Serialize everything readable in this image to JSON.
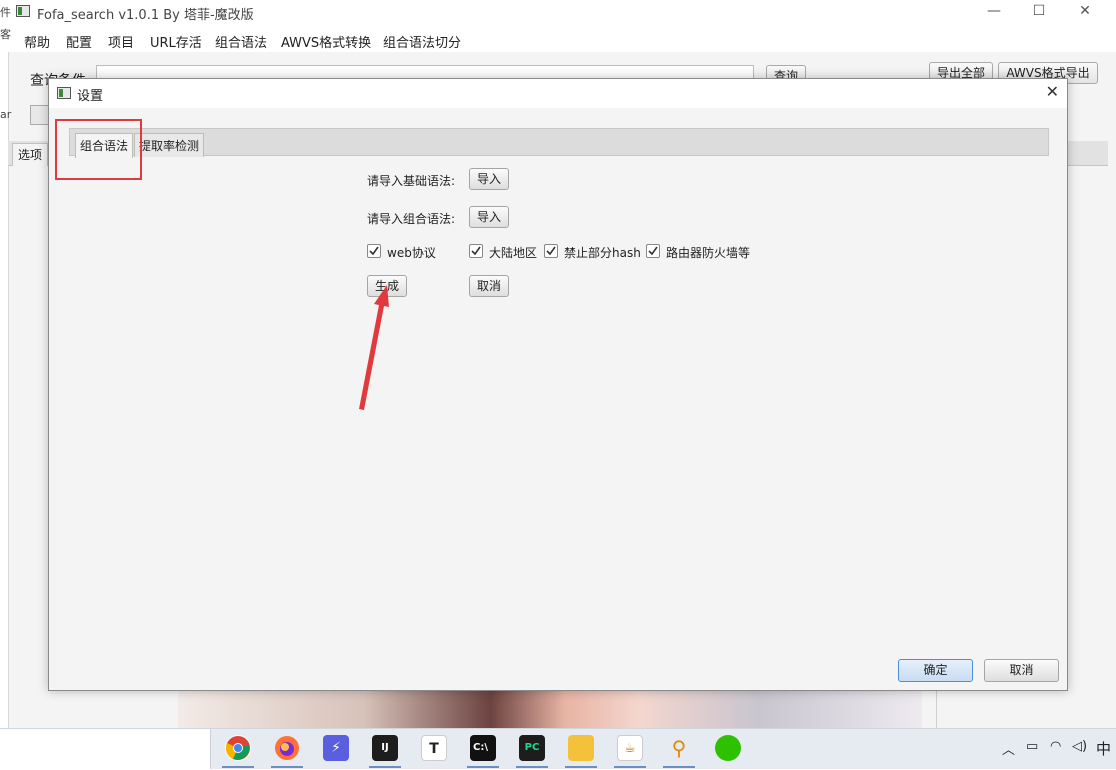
{
  "main_window": {
    "title": "Fofa_search v1.0.1 By 塔菲-魔改版",
    "left_edge_glyphs": [
      "件",
      "客",
      "ar"
    ],
    "controls": {
      "minimize": "—",
      "maximize": "☐",
      "close": "✕"
    },
    "menu": [
      "帮助",
      "配置",
      "项目",
      "URL存活",
      "组合语法",
      "AWVS格式转换",
      "组合语法切分"
    ],
    "query_label": "查询条件",
    "query_button": "查询",
    "export_all_button": "导出全部",
    "awvs_export_button": "AWVS格式导出",
    "tab_label": "选项"
  },
  "dialog": {
    "title": "设置",
    "close": "✕",
    "tabs": [
      {
        "label": "组合语法",
        "active": true
      },
      {
        "label": "提取率检测",
        "active": false
      }
    ],
    "import_base_label": "请导入基础语法:",
    "import_base_button": "导入",
    "import_combo_label": "请导入组合语法:",
    "import_combo_button": "导入",
    "checkboxes": [
      {
        "label": "web协议",
        "checked": true
      },
      {
        "label": "大陆地区",
        "checked": true
      },
      {
        "label": "禁止部分hash",
        "checked": true
      },
      {
        "label": "路由器防火墙等",
        "checked": true
      }
    ],
    "generate_button": "生成",
    "cancel_small_button": "取消",
    "ok_button": "确定",
    "cancel_button": "取消"
  },
  "annotation": {
    "color": "#e0393e"
  },
  "taskbar": {
    "apps": [
      "chrome",
      "firefox",
      "thunder",
      "intellij-idea",
      "typora",
      "terminal",
      "pycharm",
      "file-explorer",
      "java",
      "search-tool",
      "wechat"
    ],
    "tray_ime": "中"
  }
}
